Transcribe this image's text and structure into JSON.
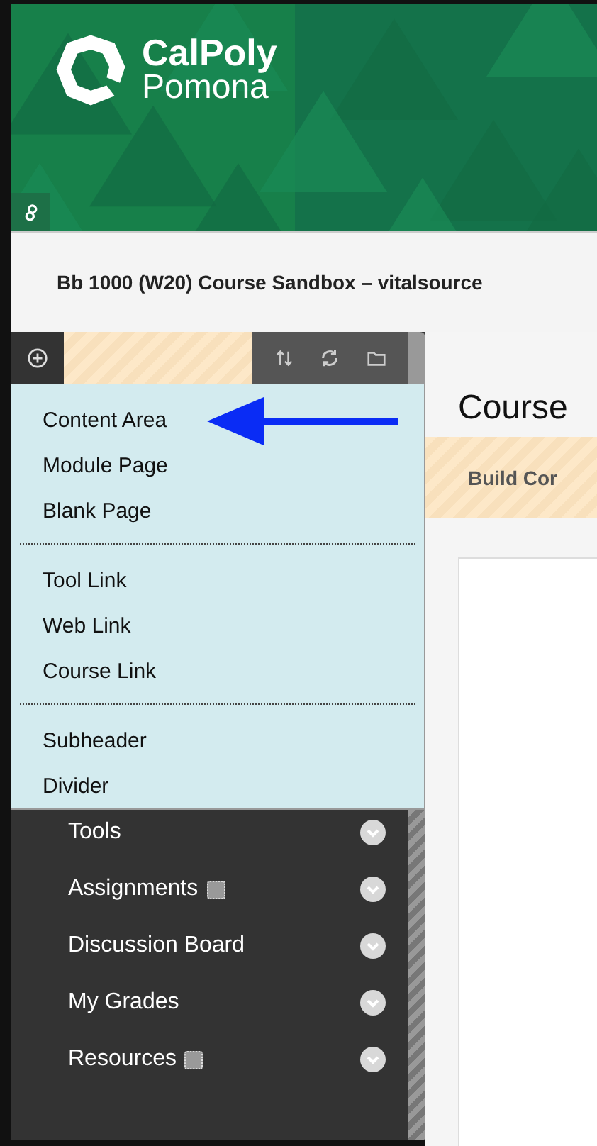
{
  "header": {
    "logo_line_1": "CalPoly",
    "logo_line_2": "Pomona"
  },
  "course_title": "Bb 1000 (W20) Course Sandbox – vitalsource",
  "add_menu": {
    "groups": [
      {
        "items": [
          "Content Area",
          "Module Page",
          "Blank Page"
        ]
      },
      {
        "items": [
          "Tool Link",
          "Web Link",
          "Course Link"
        ]
      },
      {
        "items": [
          "Subheader",
          "Divider"
        ]
      }
    ]
  },
  "course_menu": [
    {
      "label": "Tools",
      "unavailable": false
    },
    {
      "label": "Assignments",
      "unavailable": true
    },
    {
      "label": "Discussion Board",
      "unavailable": false
    },
    {
      "label": "My Grades",
      "unavailable": false
    },
    {
      "label": "Resources",
      "unavailable": true
    }
  ],
  "content": {
    "page_title": "Course",
    "action_bar_label": "Build Cor"
  }
}
